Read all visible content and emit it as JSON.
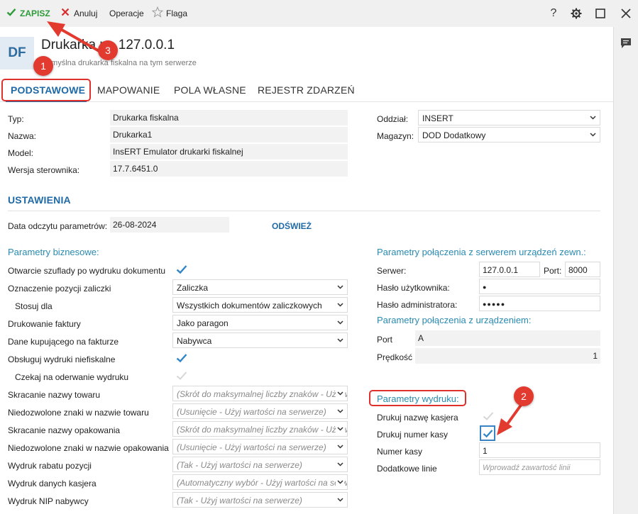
{
  "toolbar": {
    "save_label": "ZAPISZ",
    "cancel_label": "Anuluj",
    "operations_label": "Operacje",
    "flag_label": "Flaga"
  },
  "header": {
    "avatar_text": "DF",
    "title": "Drukarka na 127.0.0.1",
    "subtitle": "Domyślna drukarka fiskalna na tym serwerze"
  },
  "tabs": [
    "PODSTAWOWE",
    "MAPOWANIE",
    "POLA WŁASNE",
    "REJESTR ZDARZEŃ"
  ],
  "basic": {
    "type_label": "Typ:",
    "type_value": "Drukarka fiskalna",
    "name_label": "Nazwa:",
    "name_value": "Drukarka1",
    "model_label": "Model:",
    "model_value": "InsERT Emulator drukarki fiskalnej",
    "driver_label": "Wersja sterownika:",
    "driver_value": "17.7.6451.0",
    "branch_label": "Oddział:",
    "branch_value": "INSERT",
    "warehouse_label": "Magazyn:",
    "warehouse_value": "DOD Dodatkowy"
  },
  "settings": {
    "title": "USTAWIENIA",
    "read_date_label": "Data odczytu parametrów:",
    "read_date_value": "26-08-2024",
    "refresh_label": "ODŚWIEŻ"
  },
  "business": {
    "title": "Parametry biznesowe:",
    "rows": [
      {
        "label": "Otwarcie szuflady po wydruku dokumentu"
      },
      {
        "label": "Oznaczenie pozycji zaliczki",
        "value": "Zaliczka"
      },
      {
        "label": "Stosuj dla",
        "value": "Wszystkich dokumentów zaliczkowych"
      },
      {
        "label": "Drukowanie faktury",
        "value": "Jako paragon"
      },
      {
        "label": "Dane kupującego na fakturze",
        "value": "Nabywca"
      },
      {
        "label": "Obsługuj wydruki niefiskalne"
      },
      {
        "label": "Czekaj na oderwanie wydruku"
      },
      {
        "label": "Skracanie nazwy towaru",
        "value": "(Skrót do maksymalnej liczby znaków - Użyj wartości na serwerze)"
      },
      {
        "label": "Niedozwolone znaki w nazwie towaru",
        "value": "(Usunięcie - Użyj wartości na serwerze)"
      },
      {
        "label": "Skracanie nazwy opakowania",
        "value": "(Skrót do maksymalnej liczby znaków - Użyj wartości na serwerze)"
      },
      {
        "label": "Niedozwolone znaki w nazwie opakowania",
        "value": "(Usunięcie - Użyj wartości na serwerze)"
      },
      {
        "label": "Wydruk rabatu pozycji",
        "value": "(Tak - Użyj wartości na serwerze)"
      },
      {
        "label": "Wydruk danych kasjera",
        "value": "(Automatyczny wybór - Użyj wartości na serwerze)"
      },
      {
        "label": "Wydruk NIP nabywcy",
        "value": "(Tak - Użyj wartości na serwerze)"
      }
    ]
  },
  "server_conn": {
    "title": "Parametry połączenia z serwerem urządzeń zewn.:",
    "server_label": "Serwer:",
    "server_value": "127.0.0.1",
    "port_label": "Port:",
    "port_value": "8000",
    "user_pass_label": "Hasło użytkownika:",
    "user_pass_value": "●",
    "admin_pass_label": "Hasło administratora:",
    "admin_pass_value": "●●●●●"
  },
  "device_conn": {
    "title": "Parametry połączenia z urządzeniem:",
    "port_label": "Port",
    "port_value": "A",
    "speed_label": "Prędkość",
    "speed_value": "1"
  },
  "print_params": {
    "title": "Parametry wydruku:",
    "cashier_label": "Drukuj nazwę kasjera",
    "register_label": "Drukuj numer kasy",
    "register_no_label": "Numer kasy",
    "register_no_value": "1",
    "extra_lines_label": "Dodatkowe linie",
    "extra_lines_placeholder": "Wprowadź zawartość linii"
  },
  "annotations": {
    "badge_1": "1",
    "badge_2": "2",
    "badge_3": "3"
  },
  "colors": {
    "accent": "#1f6aa6",
    "save_green": "#2e9b3a",
    "cancel_red": "#d92b2b",
    "annotation_red": "#e33a2f",
    "checkbox_blue": "#2f86c9"
  }
}
